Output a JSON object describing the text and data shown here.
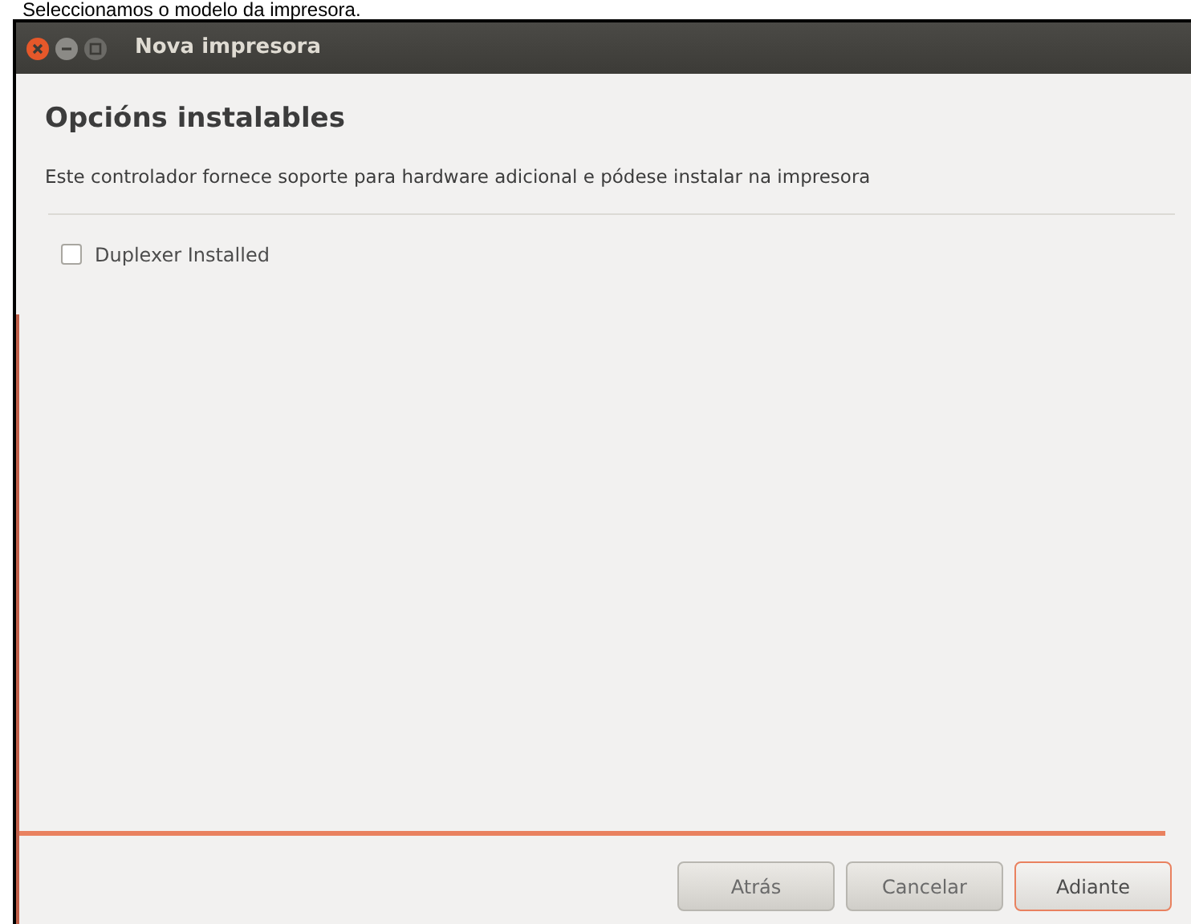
{
  "caption": "Seleccionamos o modelo da impresora.",
  "window": {
    "title": "Nova impresora"
  },
  "heading": "Opcións instalables",
  "description": "Este controlador fornece soporte para hardware adicional e pódese instalar na impresora",
  "options": [
    {
      "label": "Duplexer Installed",
      "checked": false
    }
  ],
  "buttons": [
    {
      "label": "Atrás",
      "selected": false
    },
    {
      "label": "Cancelar",
      "selected": false
    },
    {
      "label": "Adiante",
      "selected": true
    }
  ]
}
